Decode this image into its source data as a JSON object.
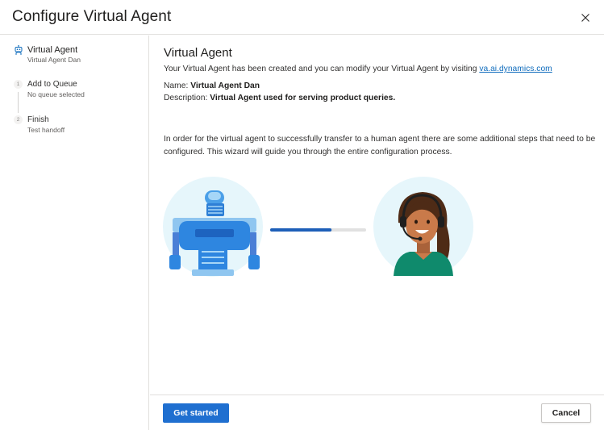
{
  "dialog": {
    "title": "Configure Virtual Agent",
    "close_icon": "close-icon"
  },
  "sidebar": {
    "steps": [
      {
        "title": "Virtual Agent",
        "subtitle": "Virtual Agent Dan",
        "icon": "bot-icon",
        "active": true
      },
      {
        "number": "1",
        "title": "Add to Queue",
        "subtitle": "No queue selected",
        "active": false
      },
      {
        "number": "2",
        "title": "Finish",
        "subtitle": "Test handoff",
        "active": false
      }
    ]
  },
  "main": {
    "heading": "Virtual Agent",
    "intro_text": "Your Virtual Agent has been created and you can modify your Virtual Agent by visiting ",
    "intro_link": "va.ai.dynamics.com",
    "name_label": "Name: ",
    "name_value": "Virtual Agent Dan",
    "description_label": "Description: ",
    "description_value": "Virtual Agent used for serving product queries.",
    "info_text": "In order for the virtual agent to successfully transfer to a human agent there are some additional steps that need to be configured. This wizard will guide you through the entire configuration process.",
    "illustration": {
      "left_icon": "robot-icon",
      "right_icon": "human-agent-headset-icon",
      "transfer_progress": 0.64
    }
  },
  "footer": {
    "primary_label": "Get started",
    "secondary_label": "Cancel"
  },
  "colors": {
    "accent": "#1f6fd0",
    "link": "#0f6cbd",
    "progress_fill": "#1d5fb8",
    "progress_track": "#e1e1e1",
    "illustration_bg": "#e6f6fb"
  }
}
